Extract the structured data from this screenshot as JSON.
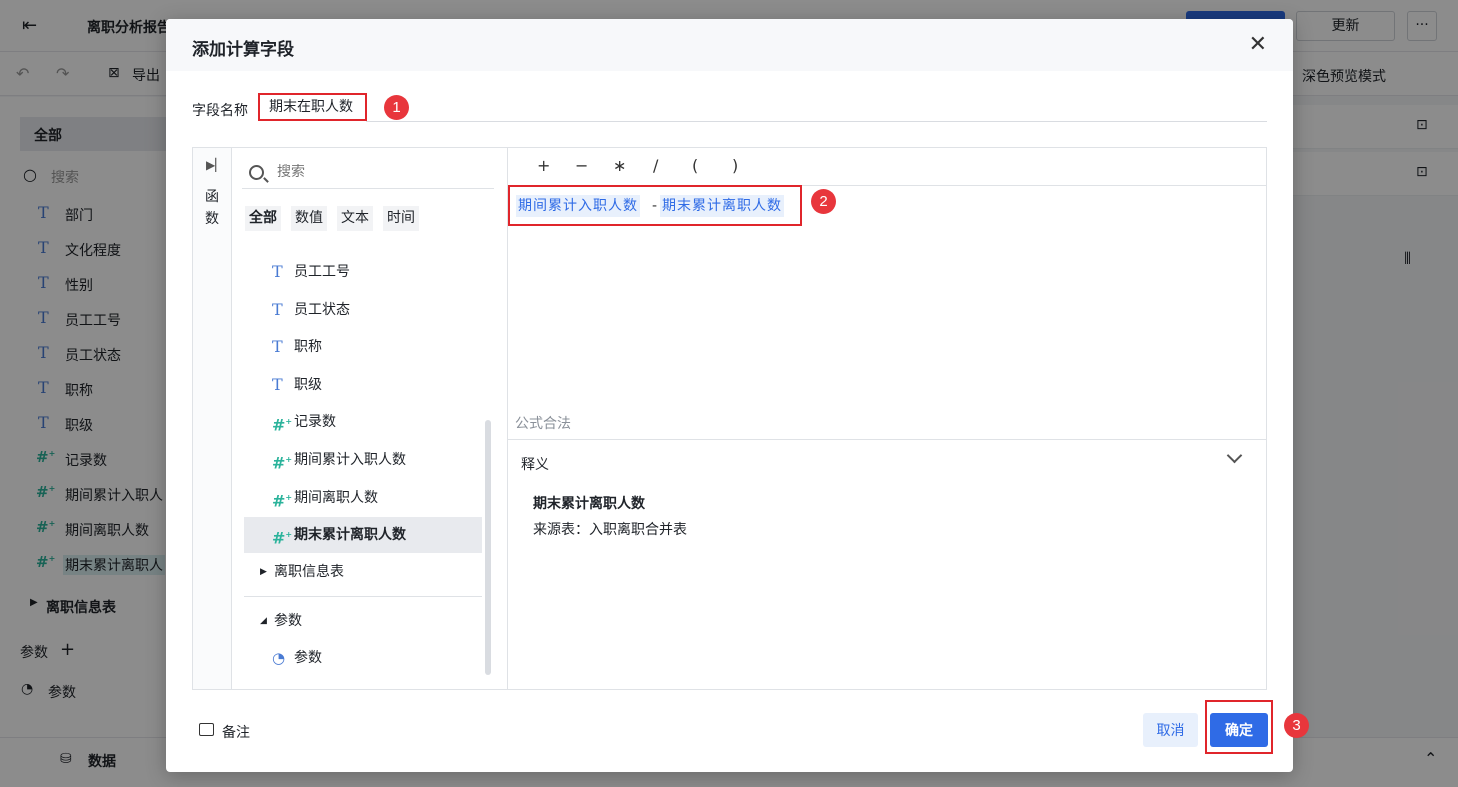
{
  "app": {
    "title": "离职分析报告",
    "toolbar": {
      "export_label": "导出",
      "dark_preview_label": "深色预览模式"
    },
    "update_label": "更新",
    "more_label": "···",
    "left_panel": {
      "all_label": "全部",
      "search_placeholder": "搜索",
      "fields": [
        {
          "type": "T",
          "label": "部门"
        },
        {
          "type": "T",
          "label": "文化程度"
        },
        {
          "type": "T",
          "label": "性别"
        },
        {
          "type": "T",
          "label": "员工工号"
        },
        {
          "type": "T",
          "label": "员工状态"
        },
        {
          "type": "T",
          "label": "职称"
        },
        {
          "type": "T",
          "label": "职级"
        },
        {
          "type": "#",
          "label": "记录数"
        },
        {
          "type": "#",
          "label": "期间累计入职人"
        },
        {
          "type": "#",
          "label": "期间离职人数"
        },
        {
          "type": "#",
          "label": "期末累计离职人"
        }
      ],
      "table_label": "离职信息表",
      "params_label": "参数",
      "param_item": "参数"
    },
    "bottom": {
      "data_label": "数据"
    }
  },
  "dialog": {
    "title": "添加计算字段",
    "close_label": "✕",
    "field_name_label": "字段名称",
    "field_name_value": "期末在职人数",
    "badges": [
      "1",
      "2",
      "3"
    ],
    "fn_label": "函数",
    "search_placeholder": "搜索",
    "filter_tabs": [
      "全部",
      "数值",
      "文本",
      "时间"
    ],
    "fields": [
      {
        "type": "T",
        "label": "员工工号"
      },
      {
        "type": "T",
        "label": "员工状态"
      },
      {
        "type": "T",
        "label": "职称"
      },
      {
        "type": "T",
        "label": "职级"
      },
      {
        "type": "#",
        "label": "记录数"
      },
      {
        "type": "#",
        "label": "期间累计入职人数"
      },
      {
        "type": "#",
        "label": "期间离职人数"
      },
      {
        "type": "#",
        "label": "期末累计离职人数"
      }
    ],
    "table_group": "离职信息表",
    "params_group": "参数",
    "param_item": "参数",
    "operators": [
      "+",
      "−",
      "∗",
      "/",
      "(",
      ")"
    ],
    "formula": {
      "token1": "期间累计入职人数",
      "op": "-",
      "token2": "期末累计离职人数"
    },
    "valid_text": "公式合法",
    "desc_header": "释义",
    "desc_title": "期末累计离职人数",
    "desc_source": "来源表：入职离职合并表",
    "note_label": "备注",
    "cancel_label": "取消",
    "ok_label": "确定"
  },
  "colors": {
    "accent": "#2f6be6",
    "highlight": "#e0252b",
    "badge": "#e8363c",
    "number_icon": "#2bb39b",
    "text_icon": "#4a7bd3"
  }
}
